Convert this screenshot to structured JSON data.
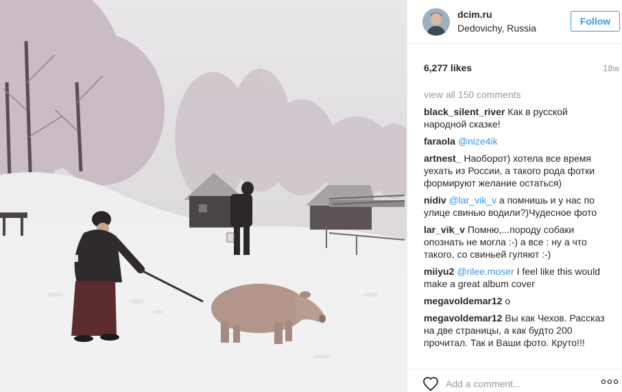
{
  "post": {
    "username": "dcim.ru",
    "location": "Dedovichy, Russia",
    "follow_label": "Follow",
    "likes": "6,277 likes",
    "age": "18w",
    "view_all": "view all 150 comments",
    "add_comment_placeholder": "Add a comment...",
    "accent_color": "#3897f0"
  },
  "comments": [
    {
      "user": "black_silent_river",
      "mention": "",
      "text": "Как в русской народной сказке!"
    },
    {
      "user": "faraola",
      "mention": "@nize4ik",
      "text": ""
    },
    {
      "user": "artnest_",
      "mention": "",
      "text": "Наоборот) хотела все время уехать из России, а такого рода фотки формируют желание остаться)"
    },
    {
      "user": "nidiv",
      "mention": "@lar_vik_v",
      "text": "а помнишь и у нас по улице свинью водили?)Чудесное фото"
    },
    {
      "user": "lar_vik_v",
      "mention": "",
      "text": "Помню,...породу собаки опознать не могла :-) а все : ну а что такого, со свиньей гуляют :-)"
    },
    {
      "user": "miiyu2",
      "mention": "@rilee.moser",
      "text": "I feel like this would make a great album cover"
    },
    {
      "user": "megavoldemar12",
      "mention": "",
      "text": "о"
    },
    {
      "user": "megavoldemar12",
      "mention": "",
      "text": "Вы как Чехов. Рассказ на две страницы, а как будто 200 прочитал. Так и Ваши фото. Круто!!!"
    }
  ],
  "icons": {
    "like": "heart-icon",
    "more": "more-options-icon",
    "avatar": "avatar"
  }
}
